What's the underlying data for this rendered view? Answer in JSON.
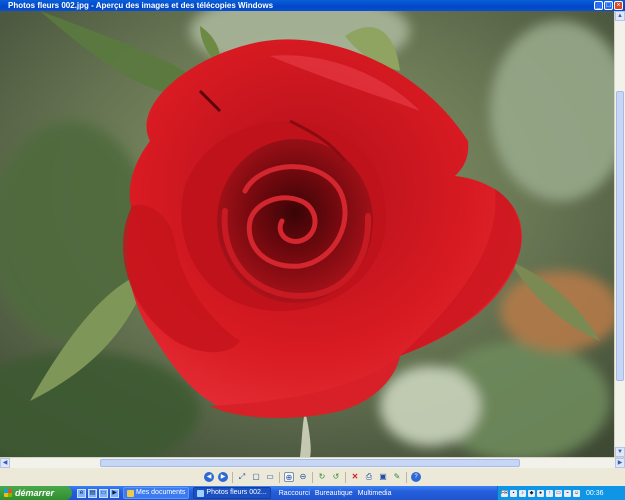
{
  "window": {
    "title": "Photos fleurs 002.jpg - Aperçu des images et des télécopies Windows",
    "buttons": {
      "minimize": "_",
      "maximize": "□",
      "close": "×"
    }
  },
  "toolbar": {
    "icons": [
      "previous-image-icon",
      "next-image-icon",
      "best-fit-icon",
      "actual-size-icon",
      "slideshow-icon",
      "zoom-in-icon",
      "zoom-out-icon",
      "rotate-clockwise-icon",
      "rotate-counterclockwise-icon",
      "delete-icon",
      "print-icon",
      "save-icon",
      "edit-icon",
      "help-icon"
    ]
  },
  "taskbar": {
    "start_label": "démarrer",
    "quick_launch": [
      "ie-icon",
      "explorer-icon",
      "desktop-icon",
      "media-icon"
    ],
    "tasks": [
      {
        "label": "Mes documents",
        "active": false
      },
      {
        "label": "Photos fleurs 002...",
        "active": true
      }
    ],
    "tray_links": [
      "Raccourci",
      "Bureautique",
      "Multimedia"
    ],
    "clock": "00:36"
  },
  "colors": {
    "titlebar": "#0047c8",
    "taskbar": "#245edb",
    "start": "#2f8f2f",
    "rose": "#d0141c"
  }
}
